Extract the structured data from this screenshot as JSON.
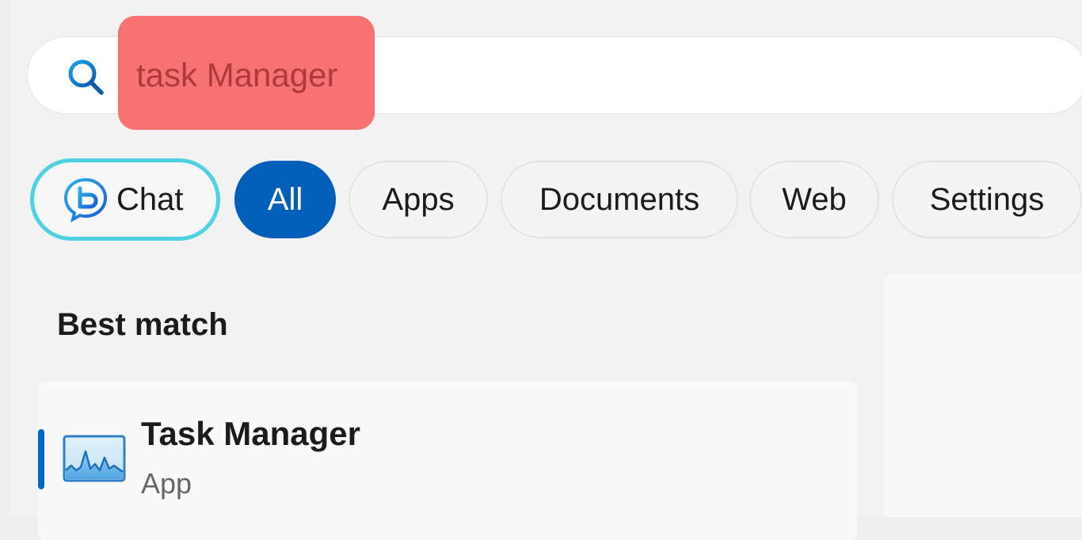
{
  "search": {
    "query": "task Manager",
    "icon": "search-icon"
  },
  "filters": {
    "chat_label": "Chat",
    "items": [
      {
        "label": "All",
        "selected": true
      },
      {
        "label": "Apps",
        "selected": false
      },
      {
        "label": "Documents",
        "selected": false
      },
      {
        "label": "Web",
        "selected": false
      },
      {
        "label": "Settings",
        "selected": false
      }
    ]
  },
  "results": {
    "section_title": "Best match",
    "best_match": {
      "title": "Task Manager",
      "subtitle": "App",
      "icon": "task-manager-icon"
    }
  },
  "colors": {
    "accent": "#005fb8",
    "highlight": "#f77272",
    "chat_border": "#4ed1e0",
    "selection_bar": "#0067c0"
  }
}
